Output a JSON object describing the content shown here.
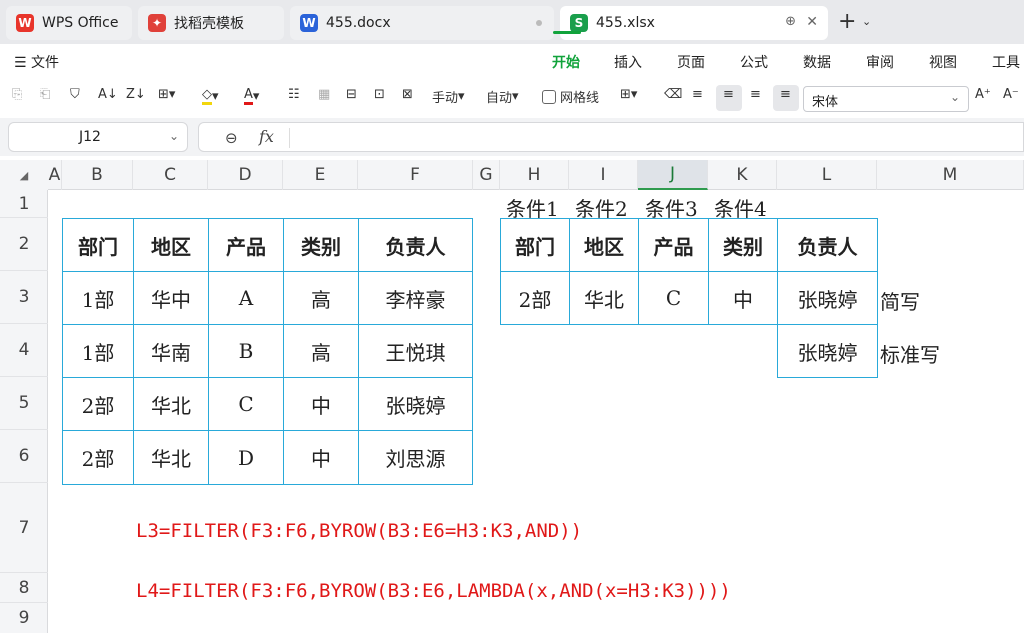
{
  "tabs": [
    {
      "label": "WPS Office",
      "icon": "wps-logo-icon",
      "color": "#e8352b"
    },
    {
      "label": "找稻壳模板",
      "icon": "docer-icon",
      "color": "#e0413a"
    },
    {
      "label": "455.docx",
      "icon": "word-doc-icon",
      "color": "#2b63d9"
    },
    {
      "label": "455.xlsx",
      "icon": "sheet-icon",
      "color": "#1a9f4c"
    }
  ],
  "menu": {
    "file": "文件",
    "items": [
      "开始",
      "插入",
      "页面",
      "公式",
      "数据",
      "审阅",
      "视图",
      "工具"
    ],
    "active": "开始"
  },
  "toolbar": {
    "manual": "手动",
    "auto": "自动",
    "gridlines": "网格线",
    "font": "宋体"
  },
  "namebox": "J12",
  "fx": "fx",
  "columns": [
    "A",
    "B",
    "C",
    "D",
    "E",
    "F",
    "G",
    "H",
    "I",
    "J",
    "K",
    "L",
    "M"
  ],
  "selected_column": "J",
  "rows": [
    "1",
    "2",
    "3",
    "4",
    "5",
    "6",
    "7",
    "8",
    "9"
  ],
  "conditions": [
    "条件1",
    "条件2",
    "条件3",
    "条件4"
  ],
  "left_table": {
    "headers": [
      "部门",
      "地区",
      "产品",
      "类别",
      "负责人"
    ],
    "rows": [
      [
        "1部",
        "华中",
        "A",
        "高",
        "李梓豪"
      ],
      [
        "1部",
        "华南",
        "B",
        "高",
        "王悦琪"
      ],
      [
        "2部",
        "华北",
        "C",
        "中",
        "张晓婷"
      ],
      [
        "2部",
        "华北",
        "D",
        "中",
        "刘思源"
      ]
    ]
  },
  "right_table": {
    "headers": [
      "部门",
      "地区",
      "产品",
      "类别",
      "负责人"
    ],
    "row": [
      "2部",
      "华北",
      "C",
      "中",
      "张晓婷"
    ],
    "l4": "张晓婷"
  },
  "notes": {
    "m3": "简写",
    "m4": "标准写"
  },
  "formulas": {
    "l3": "L3=FILTER(F3:F6,BYROW(B3:E6=H3:K3,AND))",
    "l4": "L4=FILTER(F3:F6,BYROW(B3:E6,LAMBDA(x,AND(x=H3:K3))))"
  },
  "colors": {
    "accent": "#11a33b",
    "table_border": "#29a9d9",
    "formula_text": "#e01818"
  }
}
